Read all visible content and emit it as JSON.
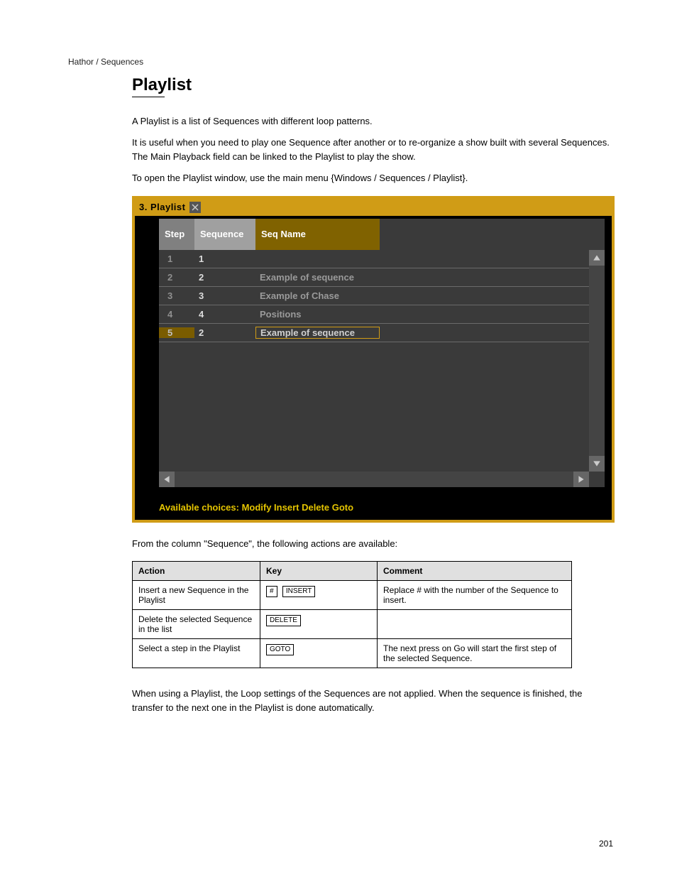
{
  "header": {
    "top_line": "Hathor / Sequences",
    "chapter": "Playlist"
  },
  "intro": {
    "p1": "A Playlist is a list of Sequences with different loop patterns.",
    "p2": "It is useful when you need to play one Sequence after another or to re-organize a show built with several Sequences. The Main Playback field can be linked to the Playlist to play the show.",
    "p3": "To open the Playlist window, use the main menu {Windows / Sequences / Playlist}."
  },
  "panel": {
    "title": "3. Playlist",
    "columns": {
      "step": "Step",
      "sequence": "Sequence",
      "seq_name": "Seq Name"
    },
    "rows": [
      {
        "step": "1",
        "sequence": "1",
        "name": ""
      },
      {
        "step": "2",
        "sequence": "2",
        "name": "Example of sequence"
      },
      {
        "step": "3",
        "sequence": "3",
        "name": "Example of Chase"
      },
      {
        "step": "4",
        "sequence": "4",
        "name": "Positions"
      },
      {
        "step": "5",
        "sequence": "2",
        "name": "Example of sequence"
      }
    ],
    "footer": "Available choices: Modify Insert Delete Goto"
  },
  "after_panel": "From the column \"Sequence\", the following actions are available:",
  "action_table": {
    "headers": {
      "action": "Action",
      "key": "Key",
      "comment": "Comment"
    },
    "rows": [
      {
        "action": "Insert a new Sequence in the Playlist",
        "keys": [
          "#",
          "INSERT"
        ],
        "comment": "Replace # with the number of the Sequence to insert."
      },
      {
        "action": "Delete the selected Sequence in the list",
        "keys": [
          "DELETE"
        ],
        "comment": ""
      },
      {
        "action": "Select a step in the Playlist",
        "keys": [
          "GOTO"
        ],
        "comment": "The next press on Go will start the first step of the selected Sequence."
      }
    ]
  },
  "footer_note": "When using a Playlist, the Loop settings of the Sequences are not applied. When the sequence is finished, the transfer to the next one in the Playlist is done automatically.",
  "page_number": "201"
}
